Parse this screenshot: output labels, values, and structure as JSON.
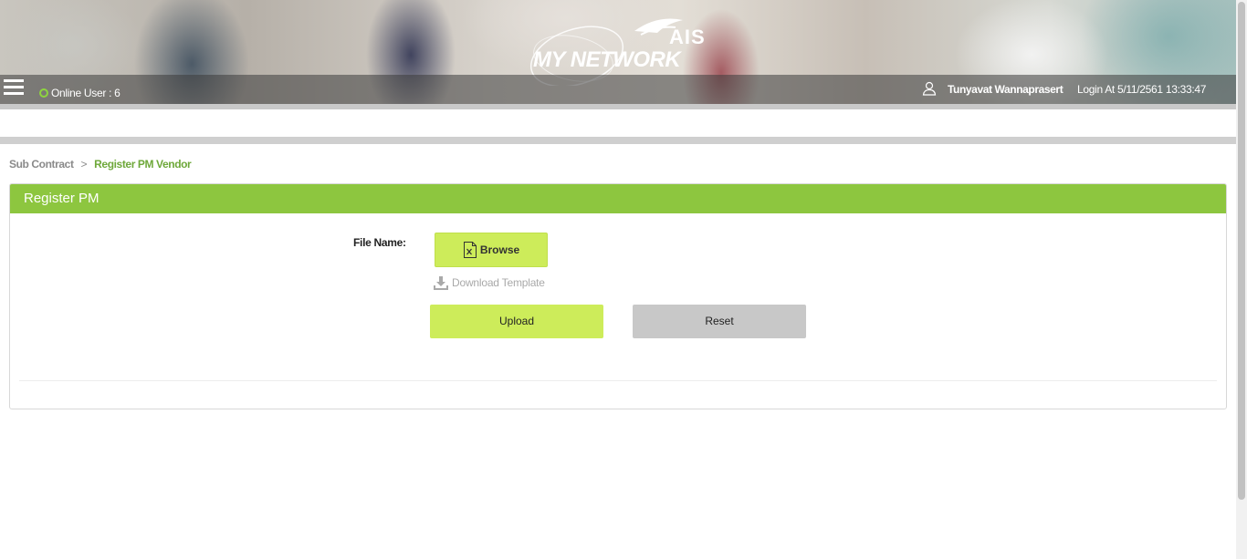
{
  "header": {
    "online_user": "Online User : 6",
    "logo_brand": "AIS",
    "logo_product": "MY NETWORK",
    "user_name": "Tunyavat Wannaprasert",
    "login_at": "Login At 5/11/2561 13:33:47",
    "icons": [
      "menu-icon",
      "online-status-icon",
      "user-icon"
    ]
  },
  "breadcrumb": {
    "parent": "Sub Contract",
    "separator": ">",
    "current": "Register PM Vendor"
  },
  "panel": {
    "title": "Register PM",
    "file_name_label": "File Name:",
    "browse_label": "Browse",
    "download_template_label": "Download Template",
    "upload_label": "Upload",
    "reset_label": "Reset"
  },
  "colors": {
    "accent_green": "#8dc63f",
    "button_lime": "#cdec5a",
    "button_gray": "#c8c8c8",
    "breadcrumb_active": "#6ea83a",
    "online_dot": "#8ed53f"
  }
}
